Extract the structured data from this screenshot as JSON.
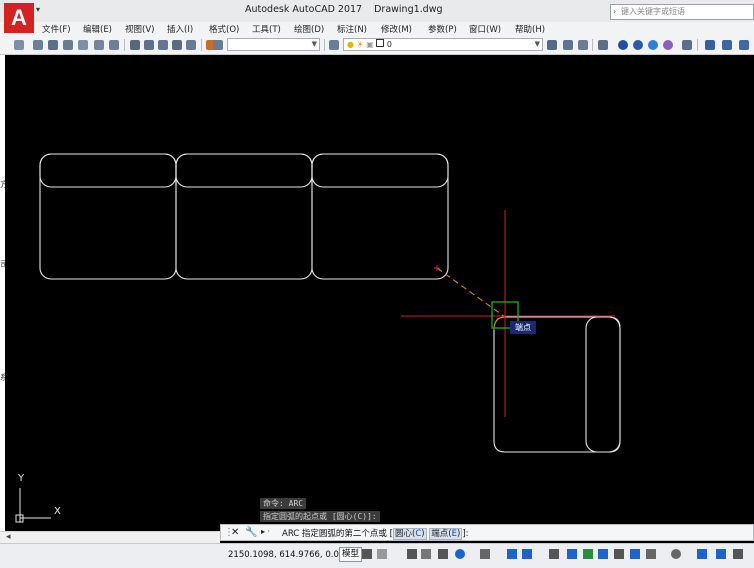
{
  "app": {
    "logo_letter": "A",
    "name": "Autodesk AutoCAD 2017",
    "file": "Drawing1.dwg"
  },
  "search": {
    "placeholder": "键入关键字或短语"
  },
  "menu": [
    "文件(F)",
    "编辑(E)",
    "视图(V)",
    "插入(I)",
    "格式(O)",
    "工具(T)",
    "绘图(D)",
    "标注(N)",
    "修改(M)",
    "参数(P)",
    "窗口(W)",
    "帮助(H)"
  ],
  "toolbar": {
    "layer_value": "0",
    "style_combo_value": ""
  },
  "snap": {
    "tooltip": "端点"
  },
  "left_ghost": [
    "方",
    "司",
    "系"
  ],
  "ucs": {
    "x_label": "X",
    "y_label": "Y"
  },
  "command": {
    "history": [
      "命令: ARC",
      "指定圆弧的起点或 [圆心(C)]:"
    ],
    "close_icon": "close-icon",
    "wrench_icon": "wrench-icon",
    "prompt_prefix": "ARC 指定圆弧的第二个点或",
    "options": [
      {
        "label": "圆心",
        "key": "C"
      },
      {
        "label": "端点",
        "key": "E"
      }
    ],
    "prompt_suffix": "]:"
  },
  "status": {
    "coords": "2150.1098, 614.9766, 0.0000",
    "model_label": "模型"
  },
  "colors": {
    "accent_red": "#d32222",
    "canvas": "#000000",
    "crosshair": "#cc2222",
    "snap_marker": "#22aa22",
    "arc_track": "#d9822b"
  }
}
